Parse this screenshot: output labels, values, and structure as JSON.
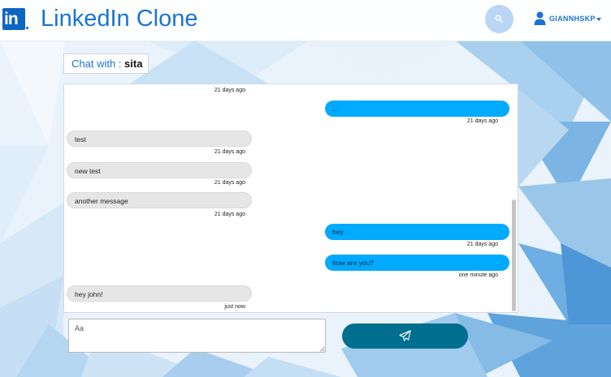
{
  "header": {
    "logo_text": "in",
    "app_title": "LinkedIn Clone",
    "username": "GIANNHSKP",
    "icons": {
      "search": "search-icon",
      "user": "user-icon",
      "caret": "caret-down-icon"
    }
  },
  "chat": {
    "label": "Chat with : ",
    "partner": "sita",
    "messages": [
      {
        "dir": "in",
        "text": "",
        "time": "21 days ago"
      },
      {
        "dir": "out",
        "text": "...",
        "time": "21 days ago"
      },
      {
        "dir": "in",
        "text": "test",
        "time": "21 days ago"
      },
      {
        "dir": "in",
        "text": "new test",
        "time": "21 days ago"
      },
      {
        "dir": "in",
        "text": "another message",
        "time": "21 days ago"
      },
      {
        "dir": "out",
        "text": "hey",
        "time": "21 days ago"
      },
      {
        "dir": "out",
        "text": "how are you?",
        "time": "one minute ago"
      },
      {
        "dir": "in",
        "text": "hey john!",
        "time": "just now"
      }
    ]
  },
  "composer": {
    "placeholder": "Aa",
    "send_icon": "paper-plane-icon"
  },
  "colors": {
    "brand": "#0a66c2",
    "outgoing_bubble": "#00aaff",
    "incoming_bubble": "#e6e6e6",
    "send_button": "#006f8f"
  }
}
